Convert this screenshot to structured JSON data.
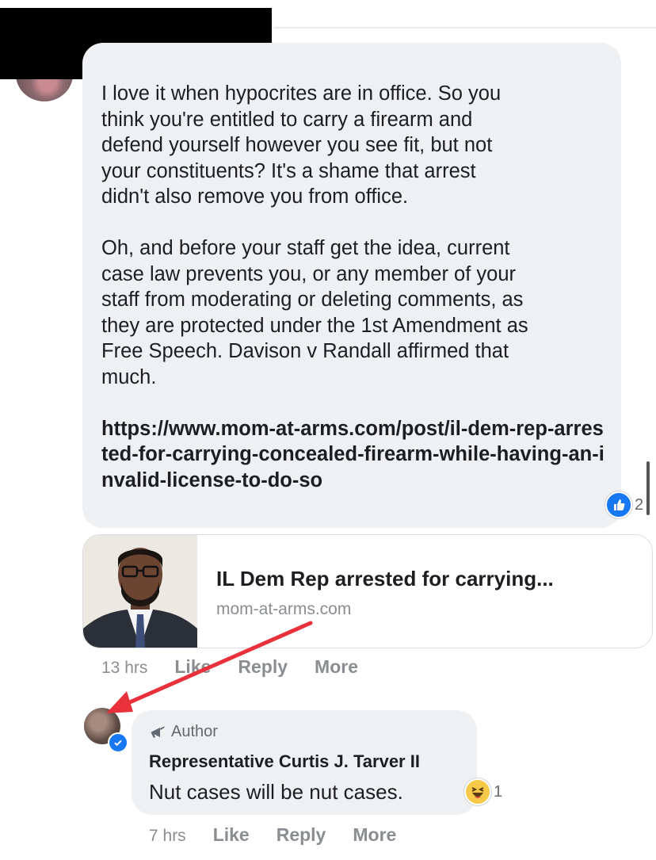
{
  "comment": {
    "paragraphs": [
      "I love it when hypocrites are in office. So you\nthink you're entitled to carry a firearm and\ndefend yourself however you see fit, but not\nyour constituents? It's a shame that arrest\ndidn't also remove you from office.",
      "Oh, and before your staff get the idea, current\ncase law prevents you, or any member of your\nstaff from moderating or deleting comments, as\nthey are protected under the 1st Amendment as\nFree Speech. Davison v Randall affirmed that\nmuch."
    ],
    "link": "https://www.mom-at-arms.com/post/il-dem-rep-arrested-for-carrying-concealed-firearm-while-having-an-invalid-license-to-do-so",
    "reaction_icon": "like-icon",
    "reaction_count": "2",
    "preview": {
      "title": "IL Dem Rep arrested for carrying...",
      "domain": "mom-at-arms.com"
    },
    "actions": {
      "time": "13 hrs",
      "like": "Like",
      "reply": "Reply",
      "more": "More"
    }
  },
  "reply": {
    "badge": "Author",
    "name": "Representative Curtis J. Tarver II",
    "text": "Nut cases will be nut cases.",
    "reaction_icon": "haha-icon",
    "reaction_count": "1",
    "actions": {
      "time": "7 hrs",
      "like": "Like",
      "reply": "Reply",
      "more": "More"
    }
  },
  "colors": {
    "bubble": "#eff0f2",
    "facebook_blue": "#1877f2",
    "annotation_arrow": "#e8313a",
    "muted_text": "#8a8d91"
  }
}
